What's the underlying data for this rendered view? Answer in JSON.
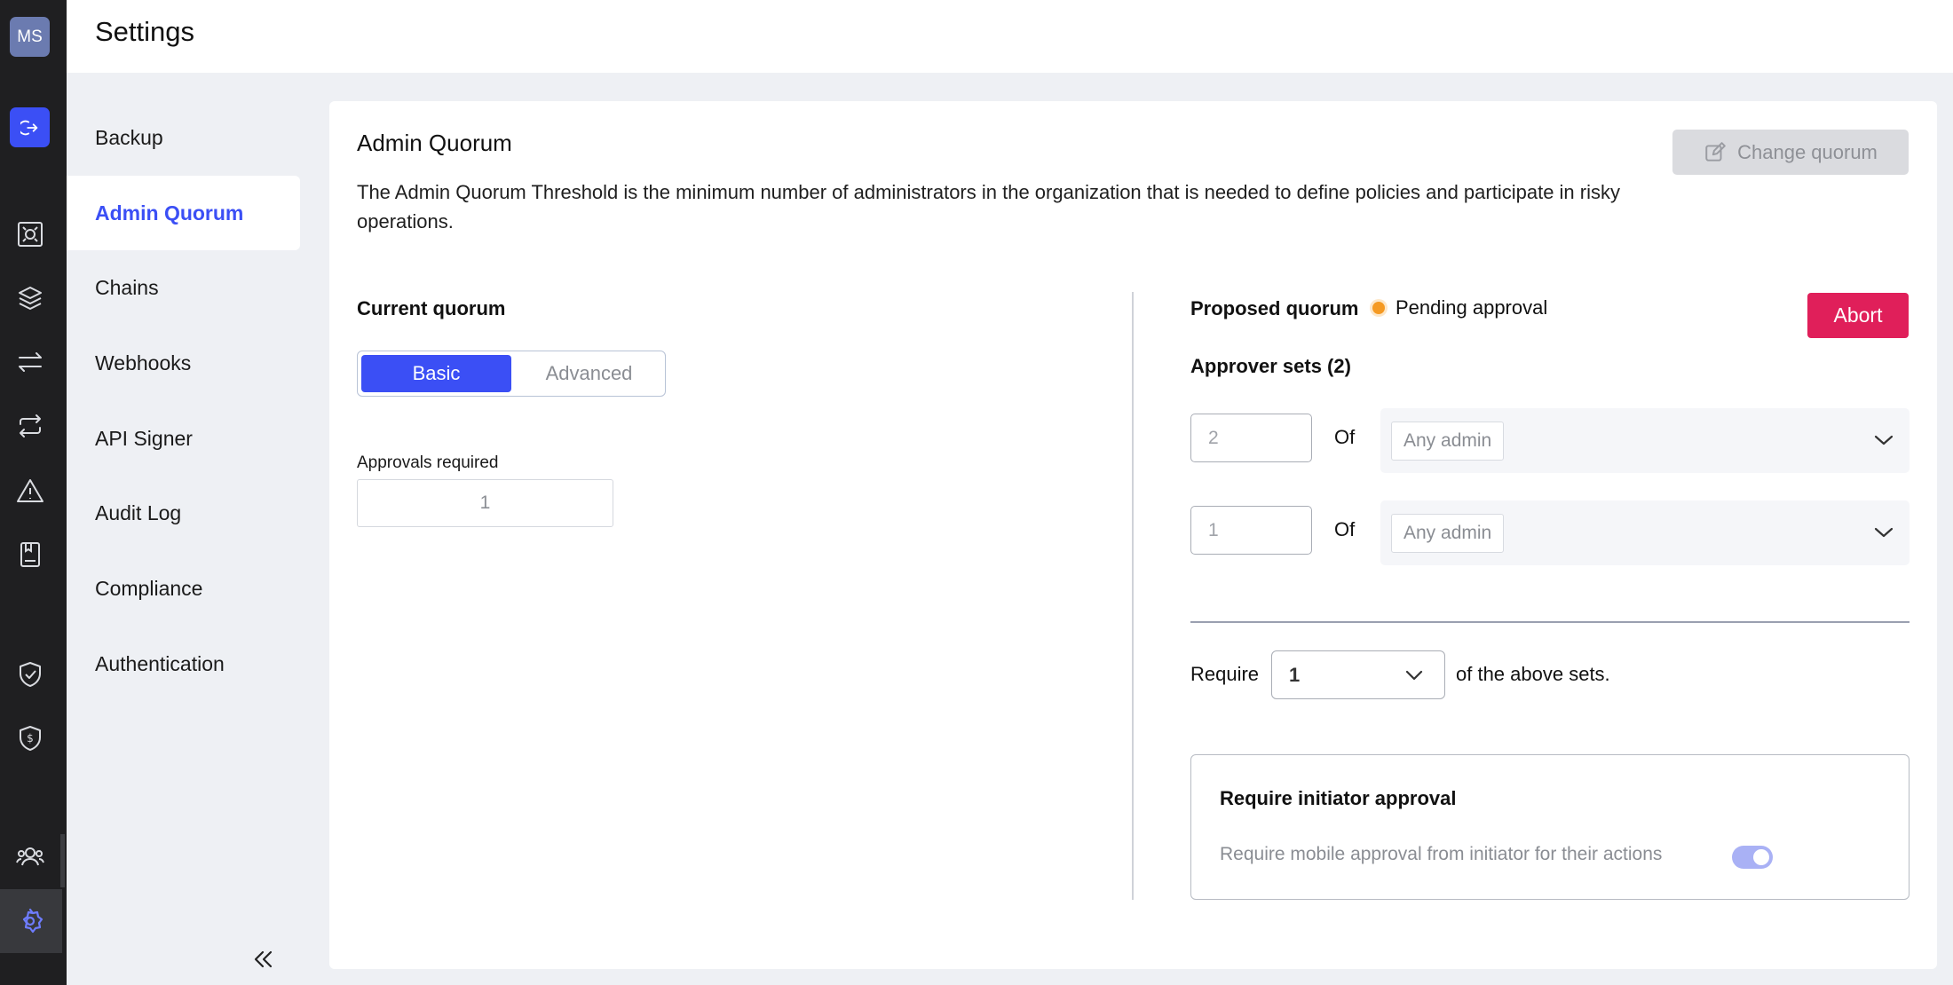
{
  "user": {
    "initials": "MS"
  },
  "header": {
    "title": "Settings"
  },
  "rail": {
    "icons": [
      "logout-icon",
      "vault-icon",
      "layers-icon",
      "transfer-icon",
      "repeat-icon",
      "alert-icon",
      "book-icon",
      "shield-check-icon",
      "shield-dollar-icon",
      "users-icon",
      "settings-icon"
    ],
    "active": "settings-icon"
  },
  "subnav": {
    "items": [
      "Backup",
      "Admin Quorum",
      "Chains",
      "Webhooks",
      "API Signer",
      "Audit Log",
      "Compliance",
      "Authentication"
    ],
    "active_index": 1
  },
  "main": {
    "title": "Admin Quorum",
    "description": "The Admin Quorum Threshold is the minimum number of administrators in the organization that is needed to define policies and participate in risky operations.",
    "change_button": "Change quorum",
    "current": {
      "label": "Current quorum",
      "mode_basic": "Basic",
      "mode_advanced": "Advanced",
      "selected_mode": "Basic",
      "approvals_label": "Approvals required",
      "approvals_value": "1"
    },
    "proposed": {
      "label": "Proposed quorum",
      "status": "Pending approval",
      "status_color": "#f59a23",
      "abort_button": "Abort",
      "abort_color": "#e01f5a",
      "sets_label": "Approver sets (2)",
      "sets": [
        {
          "count": "2",
          "of": "Of",
          "group": "Any admin"
        },
        {
          "count": "1",
          "of": "Of",
          "group": "Any admin"
        }
      ],
      "require_prefix": "Require",
      "require_value": "1",
      "require_suffix": "of the above sets.",
      "initiator": {
        "title": "Require initiator approval",
        "subtitle": "Require mobile approval from initiator for their actions",
        "toggle_on": true
      }
    }
  },
  "colors": {
    "accent": "#3b4ff5",
    "rail_bg": "#1f1f21"
  }
}
